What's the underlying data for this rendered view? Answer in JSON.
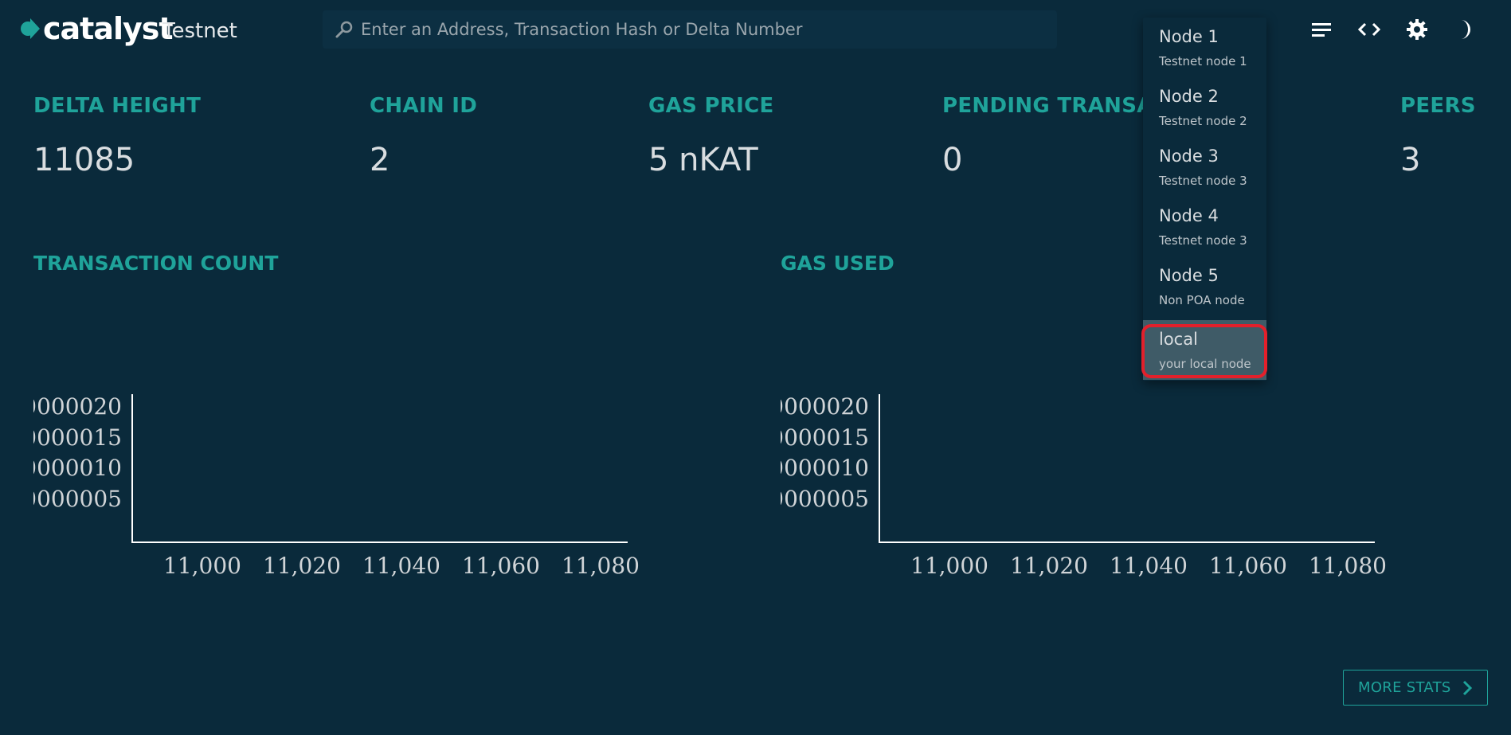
{
  "header": {
    "logo_text": "catalyst",
    "network": "Testnet",
    "search_placeholder": "Enter an Address, Transaction Hash or Delta Number",
    "icons": [
      "menu-icon",
      "code-icon",
      "gear-icon",
      "moon-icon"
    ]
  },
  "stats": [
    {
      "label": "DELTA HEIGHT",
      "value": "11085"
    },
    {
      "label": "CHAIN ID",
      "value": "2"
    },
    {
      "label": "GAS PRICE",
      "value": "5 nKAT"
    },
    {
      "label": "PENDING TRANSA",
      "value": "0"
    },
    {
      "label": "PEERS",
      "value": "3"
    }
  ],
  "charts": {
    "transactions": {
      "title": "TRANSACTION COUNT",
      "y_ticks": [
        "0000020",
        "0000015",
        "0000010",
        "0000005"
      ],
      "x_ticks": [
        "11,000",
        "11,020",
        "11,040",
        "11,060",
        "11,080"
      ]
    },
    "gas": {
      "title": "GAS USED",
      "y_ticks": [
        "0000020",
        "0000015",
        "0000010",
        "0000005"
      ],
      "x_ticks": [
        "11,000",
        "11,020",
        "11,040",
        "11,060",
        "11,080"
      ]
    }
  },
  "node_menu": {
    "items": [
      {
        "name": "Node 1",
        "description": "Testnet node 1"
      },
      {
        "name": "Node 2",
        "description": "Testnet node 2"
      },
      {
        "name": "Node 3",
        "description": "Testnet node 3"
      },
      {
        "name": "Node 4",
        "description": "Testnet node 3"
      },
      {
        "name": "Node 5",
        "description": "Non POA node"
      },
      {
        "name": "local",
        "description": "your local node"
      }
    ],
    "selected_index": 5
  },
  "more_stats_label": "MORE STATS",
  "colors": {
    "background": "#0a2a3b",
    "accent": "#1fa39a",
    "highlight": "#e3202b",
    "selected_item": "#3f5b67"
  }
}
